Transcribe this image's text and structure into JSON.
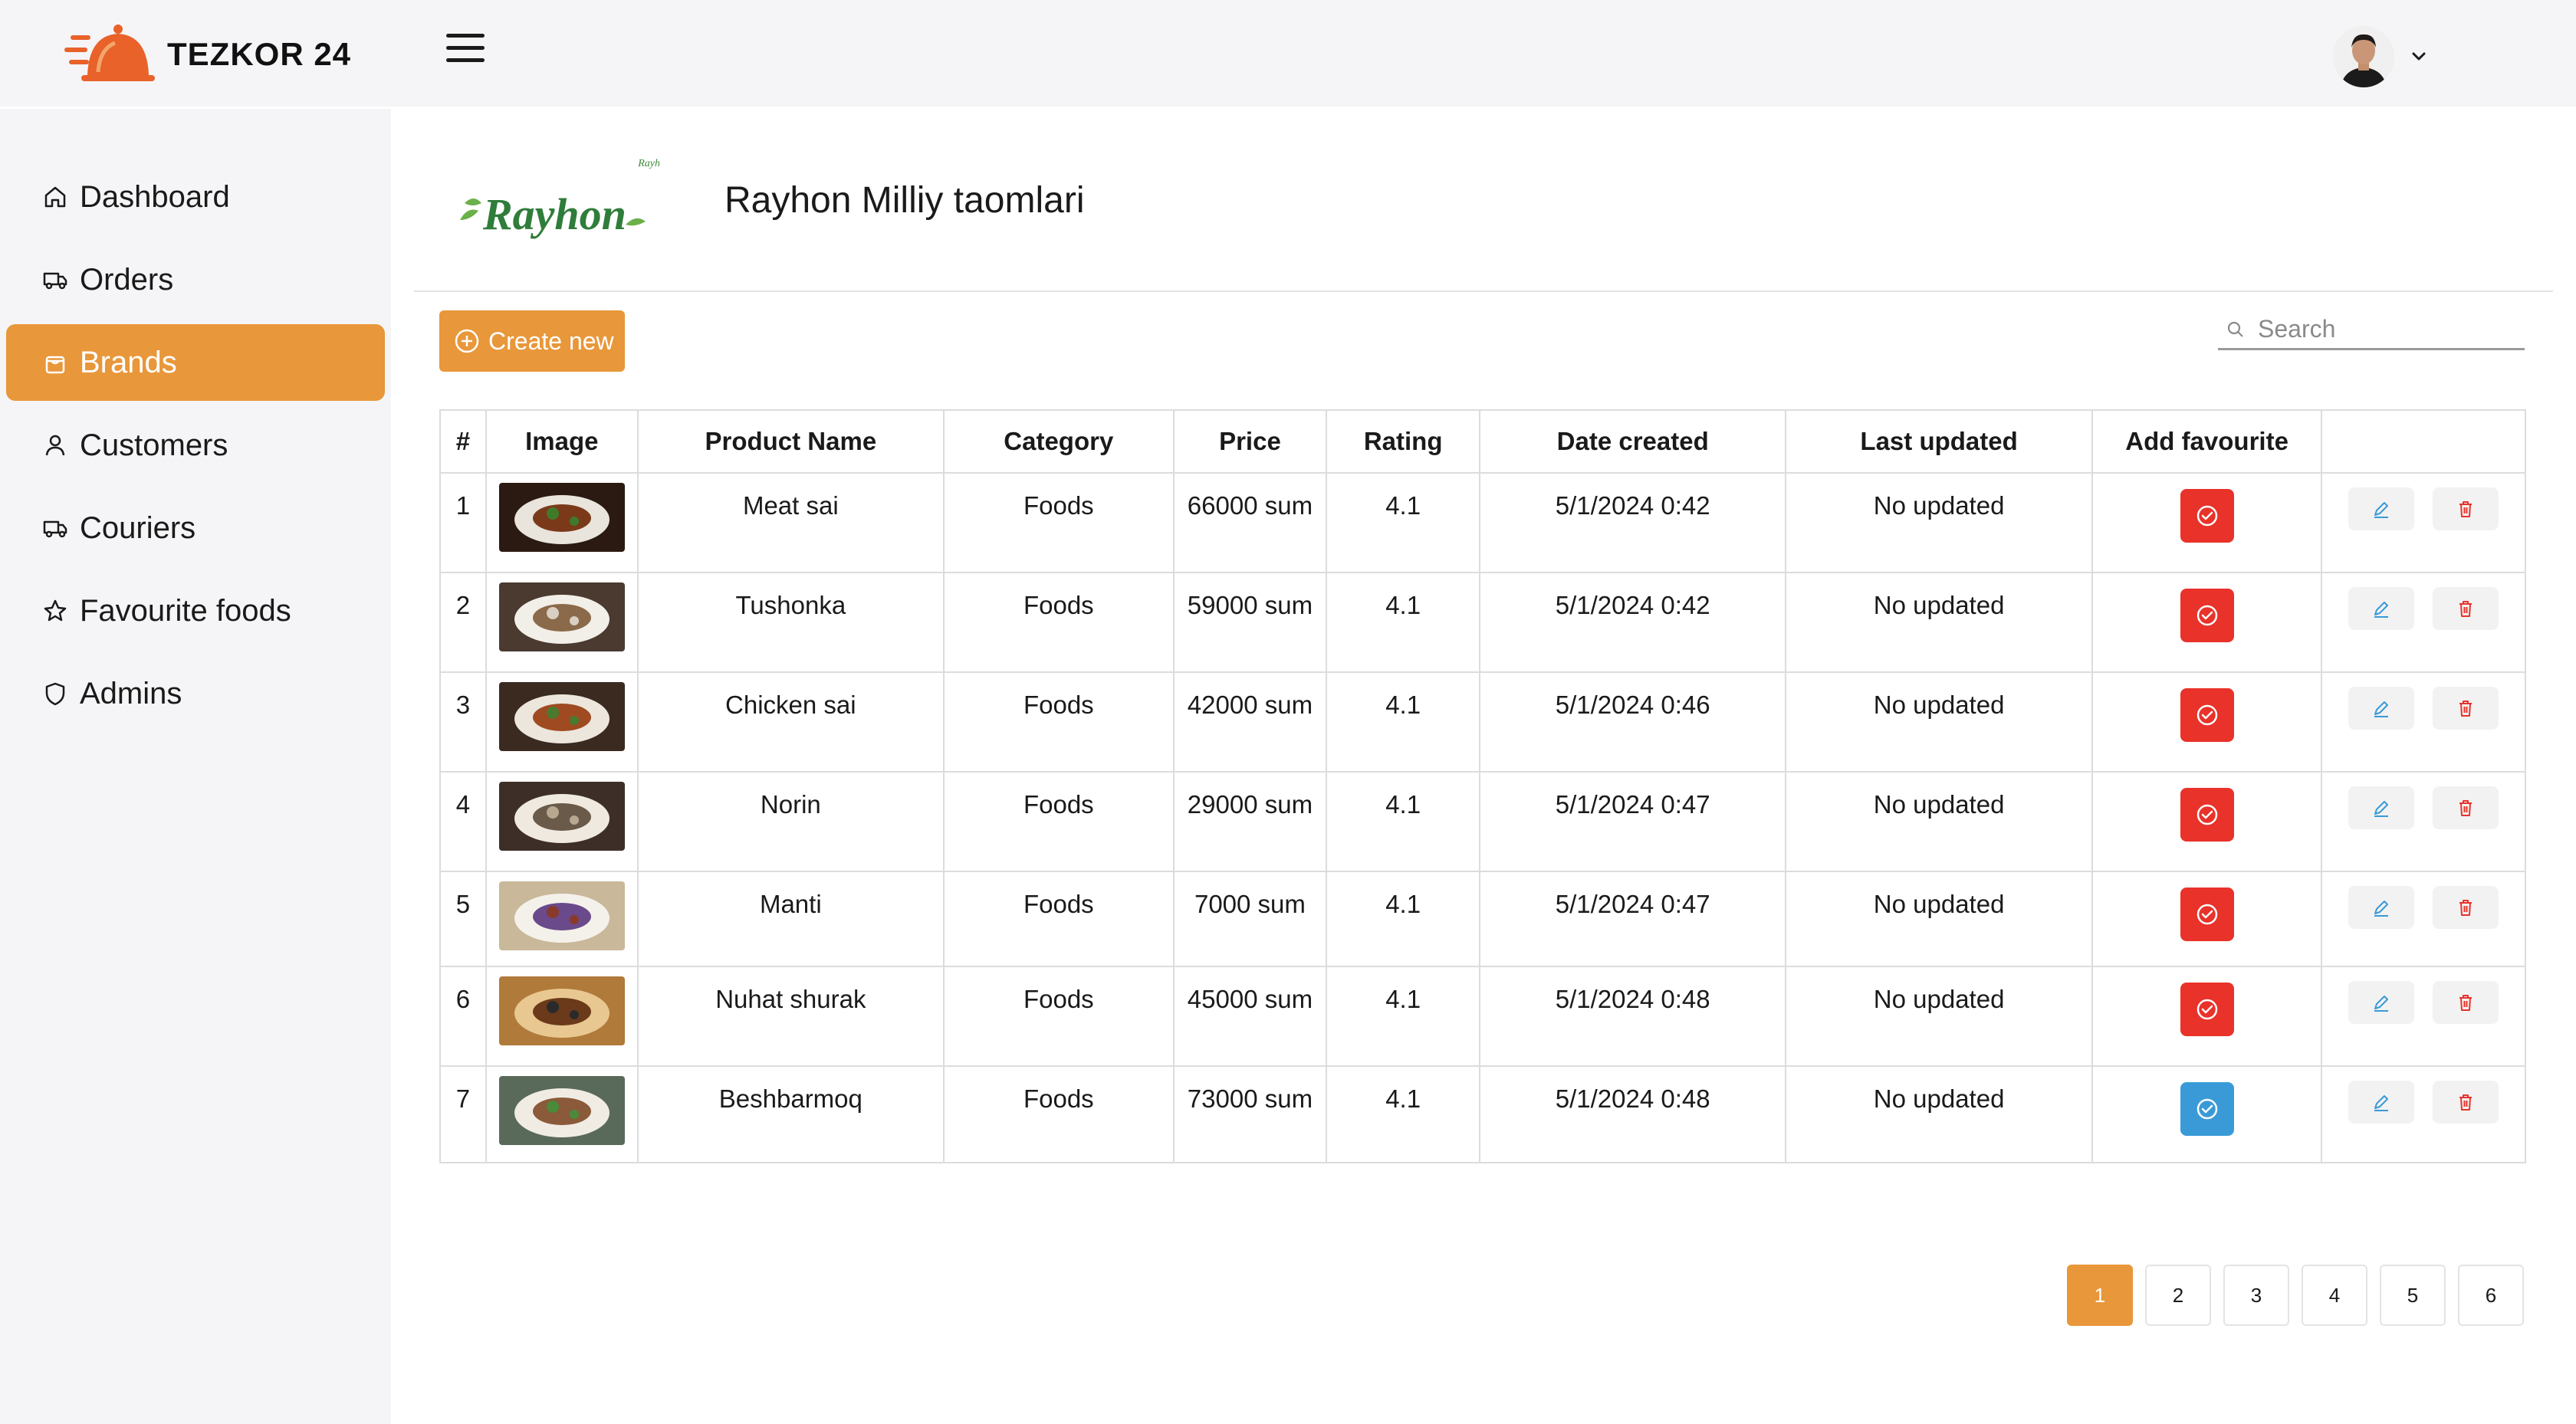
{
  "app": {
    "title": "TEZKOR 24"
  },
  "header": {
    "menu_icon": "hamburger-icon",
    "avatar": "user-avatar",
    "chevron": "chevron-down-icon"
  },
  "sidebar": {
    "items": [
      {
        "label": "Dashboard",
        "icon": "home-icon",
        "active": false
      },
      {
        "label": "Orders",
        "icon": "truck-icon",
        "active": false
      },
      {
        "label": "Brands",
        "icon": "bag-icon",
        "active": true
      },
      {
        "label": "Customers",
        "icon": "user-icon",
        "active": false
      },
      {
        "label": "Couriers",
        "icon": "truck-icon",
        "active": false
      },
      {
        "label": "Favourite foods",
        "icon": "star-icon",
        "active": false
      },
      {
        "label": "Admins",
        "icon": "shield-icon",
        "active": false
      }
    ]
  },
  "brand": {
    "logo_text": "Rayhon",
    "logo_small_text": "Rayhon",
    "title": "Rayhon Milliy taomlari"
  },
  "toolbar": {
    "create_label": "Create new",
    "search_placeholder": "Search"
  },
  "table": {
    "headers": [
      "#",
      "Image",
      "Product Name",
      "Category",
      "Price",
      "Rating",
      "Date created",
      "Last updated",
      "Add favourite",
      ""
    ],
    "rows": [
      {
        "num": "1",
        "name": "Meat sai",
        "category": "Foods",
        "price": "66000 sum",
        "rating": "4.1",
        "created": "5/1/2024 0:42",
        "updated": "No updated",
        "favourite": false
      },
      {
        "num": "2",
        "name": "Tushonka",
        "category": "Foods",
        "price": "59000 sum",
        "rating": "4.1",
        "created": "5/1/2024 0:42",
        "updated": "No updated",
        "favourite": false
      },
      {
        "num": "3",
        "name": "Chicken sai",
        "category": "Foods",
        "price": "42000 sum",
        "rating": "4.1",
        "created": "5/1/2024 0:46",
        "updated": "No updated",
        "favourite": false
      },
      {
        "num": "4",
        "name": "Norin",
        "category": "Foods",
        "price": "29000 sum",
        "rating": "4.1",
        "created": "5/1/2024 0:47",
        "updated": "No updated",
        "favourite": false
      },
      {
        "num": "5",
        "name": "Manti",
        "category": "Foods",
        "price": "7000 sum",
        "rating": "4.1",
        "created": "5/1/2024 0:47",
        "updated": "No updated",
        "favourite": false
      },
      {
        "num": "6",
        "name": "Nuhat shurak",
        "category": "Foods",
        "price": "45000 sum",
        "rating": "4.1",
        "created": "5/1/2024 0:48",
        "updated": "No updated",
        "favourite": false
      },
      {
        "num": "7",
        "name": "Beshbarmoq",
        "category": "Foods",
        "price": "73000 sum",
        "rating": "4.1",
        "created": "5/1/2024 0:48",
        "updated": "No updated",
        "favourite": true
      }
    ]
  },
  "pagination": {
    "pages": [
      "1",
      "2",
      "3",
      "4",
      "5",
      "6"
    ],
    "current": "1"
  },
  "colors": {
    "accent": "#e8973a",
    "fav_off": "#e8322a",
    "fav_on": "#3a9ad8",
    "edit": "#3a9ad8",
    "delete": "#e8322a"
  }
}
